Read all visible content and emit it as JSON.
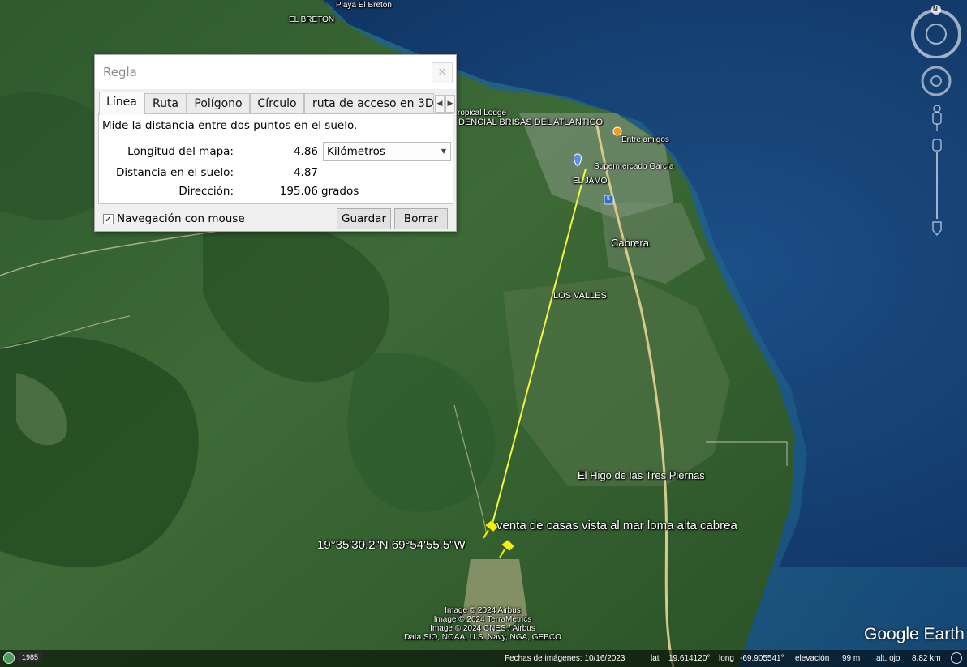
{
  "map": {
    "place_labels": {
      "playa_el_breton": "Playa El Breton",
      "el_breton": "EL BRETON",
      "tropical_lodge": "ropical Lodge",
      "residencial": "DENCIAL BRISAS DEL ATLANTICO",
      "entre_amigos": "Entre amigos",
      "supermercado": "Supermercado García",
      "el_juamo": "EL JAMO",
      "cabrera": "Cabrera",
      "los_valles": "LOS VALLES",
      "el_higo": "El Higo de las Tres Piernas"
    },
    "placemark_label": "venta de casas vista al mar loma alta cabrea",
    "coordinate_label": "19°35'30.2\"N 69°54'55.5\"W",
    "road_shield": "5",
    "attribution": [
      "Image © 2024 Airbus",
      "Image © 2024 TerraMetrics",
      "Image © 2024 CNES / Airbus",
      "Data SIO, NOAA, U.S. Navy, NGA, GEBCO"
    ],
    "brand": "Google Earth",
    "compass_letter": "N",
    "colors": {
      "ruler_line": "#f2f542",
      "pin": "#f5f000"
    }
  },
  "ruler_dialog": {
    "title": "Regla",
    "tabs": [
      "Línea",
      "Ruta",
      "Polígono",
      "Círculo",
      "ruta de acceso en 3D"
    ],
    "active_tab": "Línea",
    "description": "Mide la distancia entre dos puntos en el suelo.",
    "map_length_label": "Longitud del mapa:",
    "map_length_value": "4.86",
    "unit_selected": "Kilómetros",
    "ground_distance_label": "Distancia en el suelo:",
    "ground_distance_value": "4.87",
    "direction_label": "Dirección:",
    "direction_value": "195.06",
    "direction_unit": "grados",
    "mouse_nav_label": "Navegación con mouse",
    "mouse_nav_checked": "✓",
    "save_button": "Guardar",
    "clear_button": "Borrar"
  },
  "status_bar": {
    "history_year": "1985",
    "imagery_date": "Fechas de imágenes: 10/16/2023",
    "lat_label": "lat",
    "lat_value": "19.614120°",
    "long_label": "long",
    "long_value": "-69.905541°",
    "elev_label": "elevación",
    "elev_value": "99 m",
    "eye_alt_label": "alt. ojo",
    "eye_alt_value": "8.82 km"
  }
}
